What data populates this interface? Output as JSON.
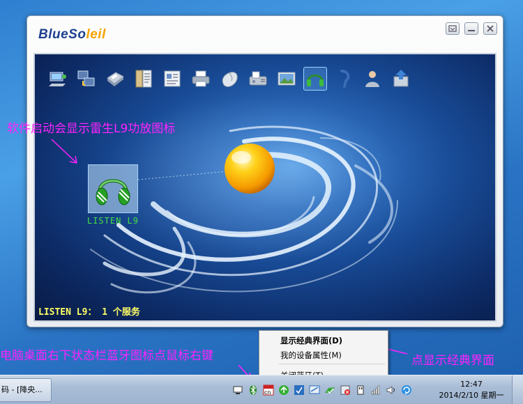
{
  "window": {
    "logo": {
      "part1": "BlueSo",
      "part2": "leil"
    },
    "buttons": [
      "minimize-box",
      "minimize",
      "close"
    ]
  },
  "toolbar": {
    "icons": [
      "computer-network-icon",
      "network-access-icon",
      "fax-printer-icon",
      "file-transfer-icon",
      "business-card-icon",
      "printer-icon",
      "mouse-icon",
      "fax-icon",
      "image-icon",
      "headphone-icon",
      "headset-icon",
      "personal-network-icon",
      "sync-icon"
    ],
    "active_index": 9
  },
  "device": {
    "label": "LISTEN L9",
    "icon": "headphone-icon"
  },
  "status_line": "LISTEN L9： 1 个服务",
  "annotations": {
    "top_left": "软件启动会显示雷生L9功放图标",
    "bottom_left": "电脑桌面右下状态栏蓝牙图标点鼠标右键",
    "bottom_right": "点显示经典界面",
    "color": "#ff22ff"
  },
  "context_menu": {
    "items": [
      {
        "label": "显示经典界面(D)",
        "bold": true
      },
      {
        "label": "我的设备属性(M)",
        "bold": false
      },
      {
        "label": "关闭蓝牙(T)",
        "bold": false
      }
    ]
  },
  "taskbar": {
    "task_button": "码 - [降央...",
    "tray_icons": [
      "network-monitor-icon",
      "bluetooth-icon",
      "ime-cn-icon",
      "update-green-icon",
      "security-shield-icon",
      "network-ok-icon",
      "check-icon",
      "remove-device-icon",
      "usb-icon",
      "signal-icon",
      "volume-icon",
      "sync-arrow-icon"
    ],
    "clock_time": "12:47",
    "clock_date": "2014/2/10 星期一"
  }
}
